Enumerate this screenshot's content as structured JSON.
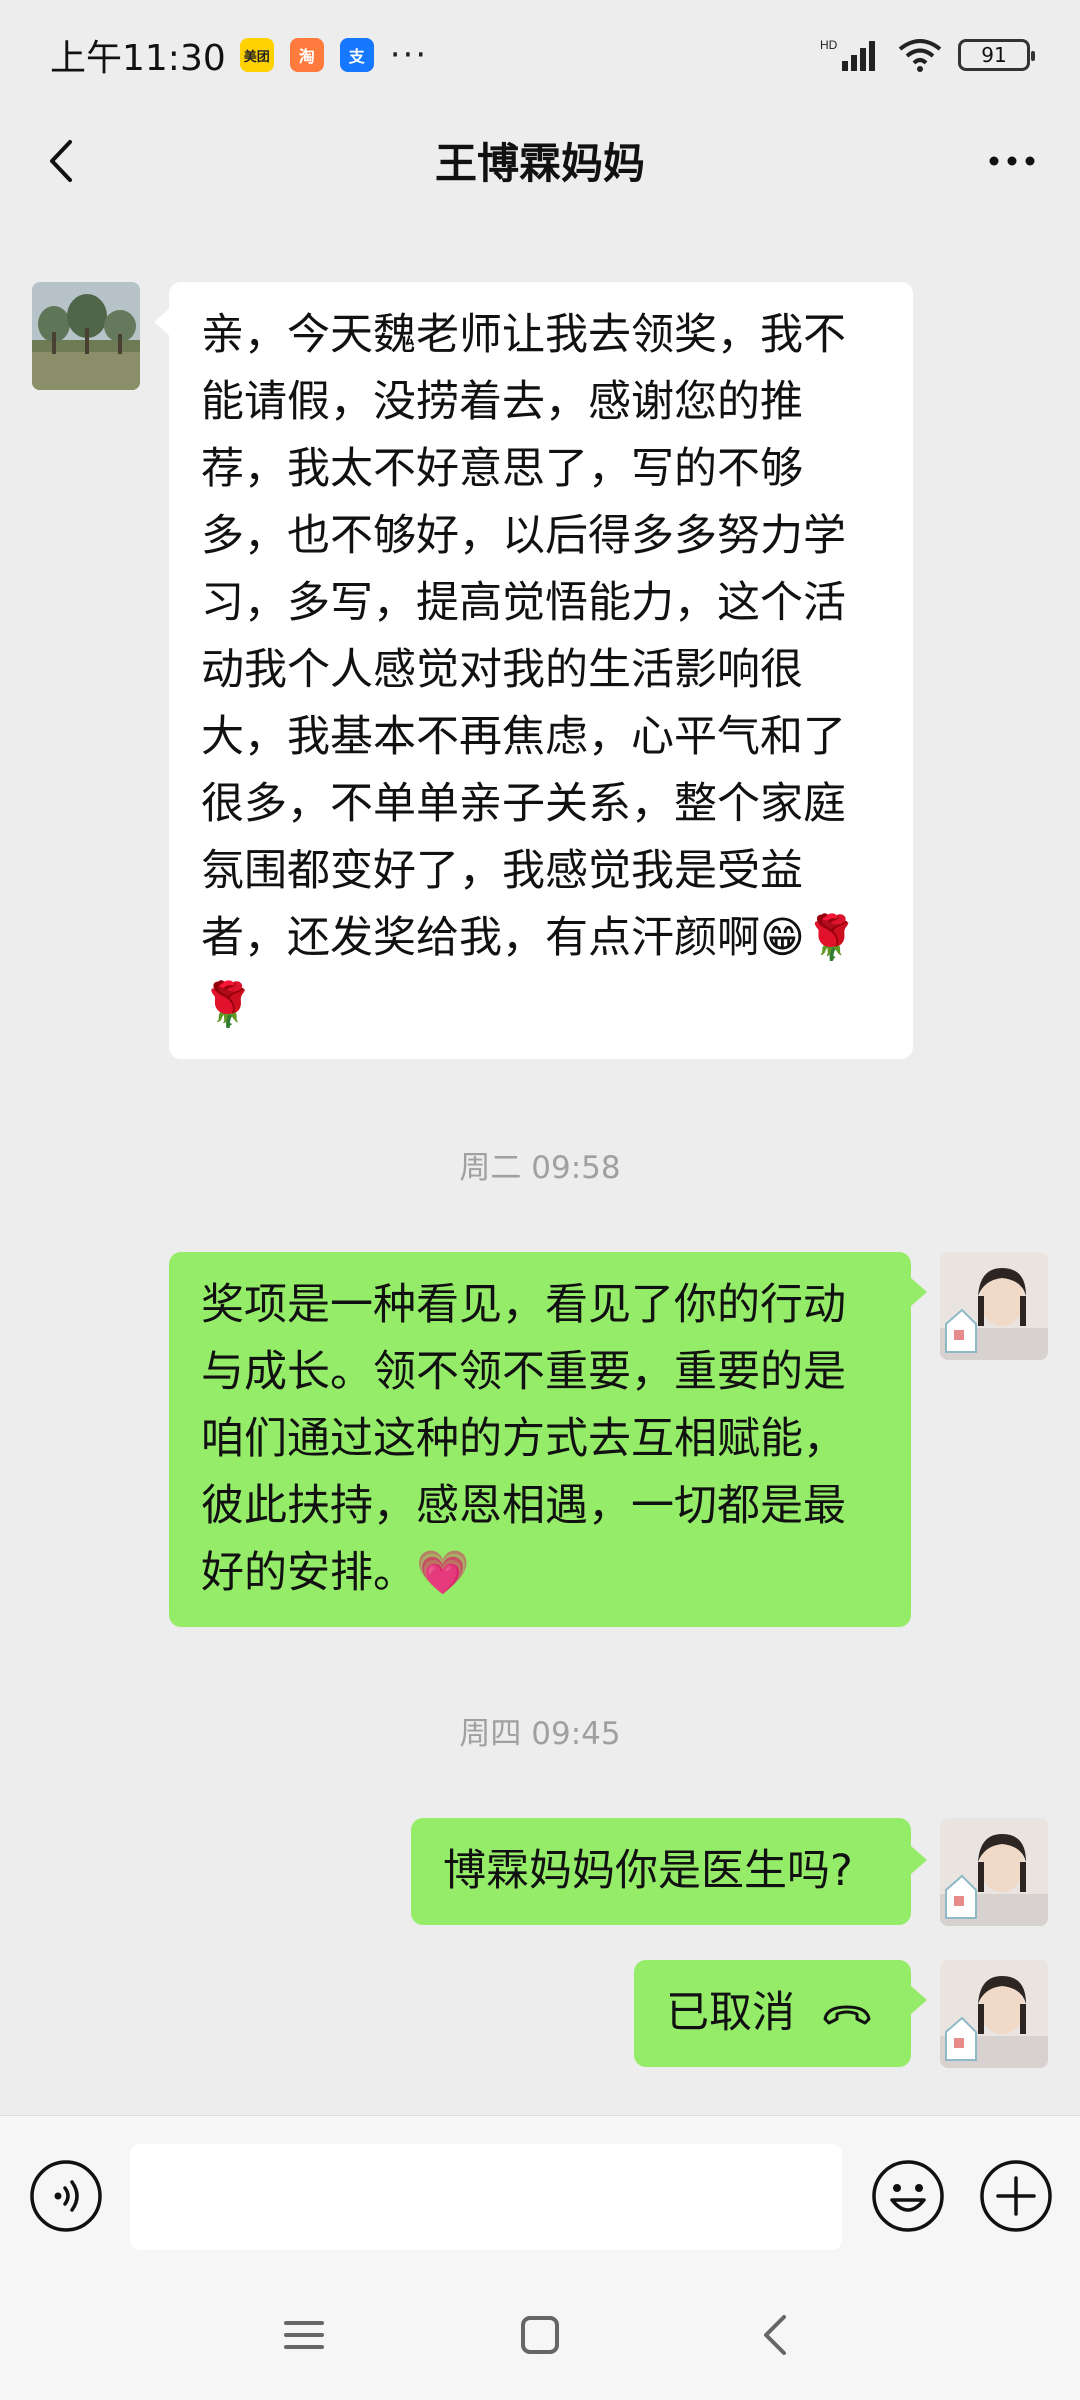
{
  "status_bar": {
    "time": "上午11:30",
    "app_icons": [
      {
        "name": "meituan-icon",
        "text": "美团",
        "color": "#ffd100",
        "text_color": "#222"
      },
      {
        "name": "taobao-icon",
        "text": "淘",
        "color": "#ff7a3d",
        "text_color": "#fff"
      },
      {
        "name": "alipay-icon",
        "text": "支",
        "color": "#1677ff",
        "text_color": "#fff"
      }
    ],
    "more": "···",
    "network": "HD",
    "battery": "91"
  },
  "header": {
    "title": "王博霖妈妈"
  },
  "messages": [
    {
      "id": "m1",
      "side": "in",
      "text": "亲，今天魏老师让我去领奖，我不能请假，没捞着去，感谢您的推荐，我太不好意思了，写的不够多，也不够好，以后得多多努力学习，多写，提高觉悟能力，这个活动我个人感觉对我的生活影响很大，我基本不再焦虑，心平气和了很多，不单单亲子关系，整个家庭氛围都变好了，我感觉我是受益者，还发奖给我，有点汗颜啊😁🌹🌹"
    },
    {
      "id": "t1",
      "type": "timestamp",
      "text": "周二 09:58"
    },
    {
      "id": "m2",
      "side": "out",
      "text": "奖项是一种看见，看见了你的行动与成长。领不领不重要，重要的是咱们通过这种的方式去互相赋能，彼此扶持，感恩相遇，一切都是最好的安排。💗"
    },
    {
      "id": "t2",
      "type": "timestamp",
      "text": "周四 09:45"
    },
    {
      "id": "m3",
      "side": "out",
      "text": "博霖妈妈你是医生吗?"
    },
    {
      "id": "m4",
      "side": "out",
      "text": "已取消",
      "icon": "hangup-icon"
    }
  ],
  "input": {
    "placeholder": ""
  },
  "colors": {
    "background": "#ededed",
    "outgoing_bubble": "#95ec69",
    "incoming_bubble": "#ffffff",
    "timestamp": "#a0a0a0"
  }
}
